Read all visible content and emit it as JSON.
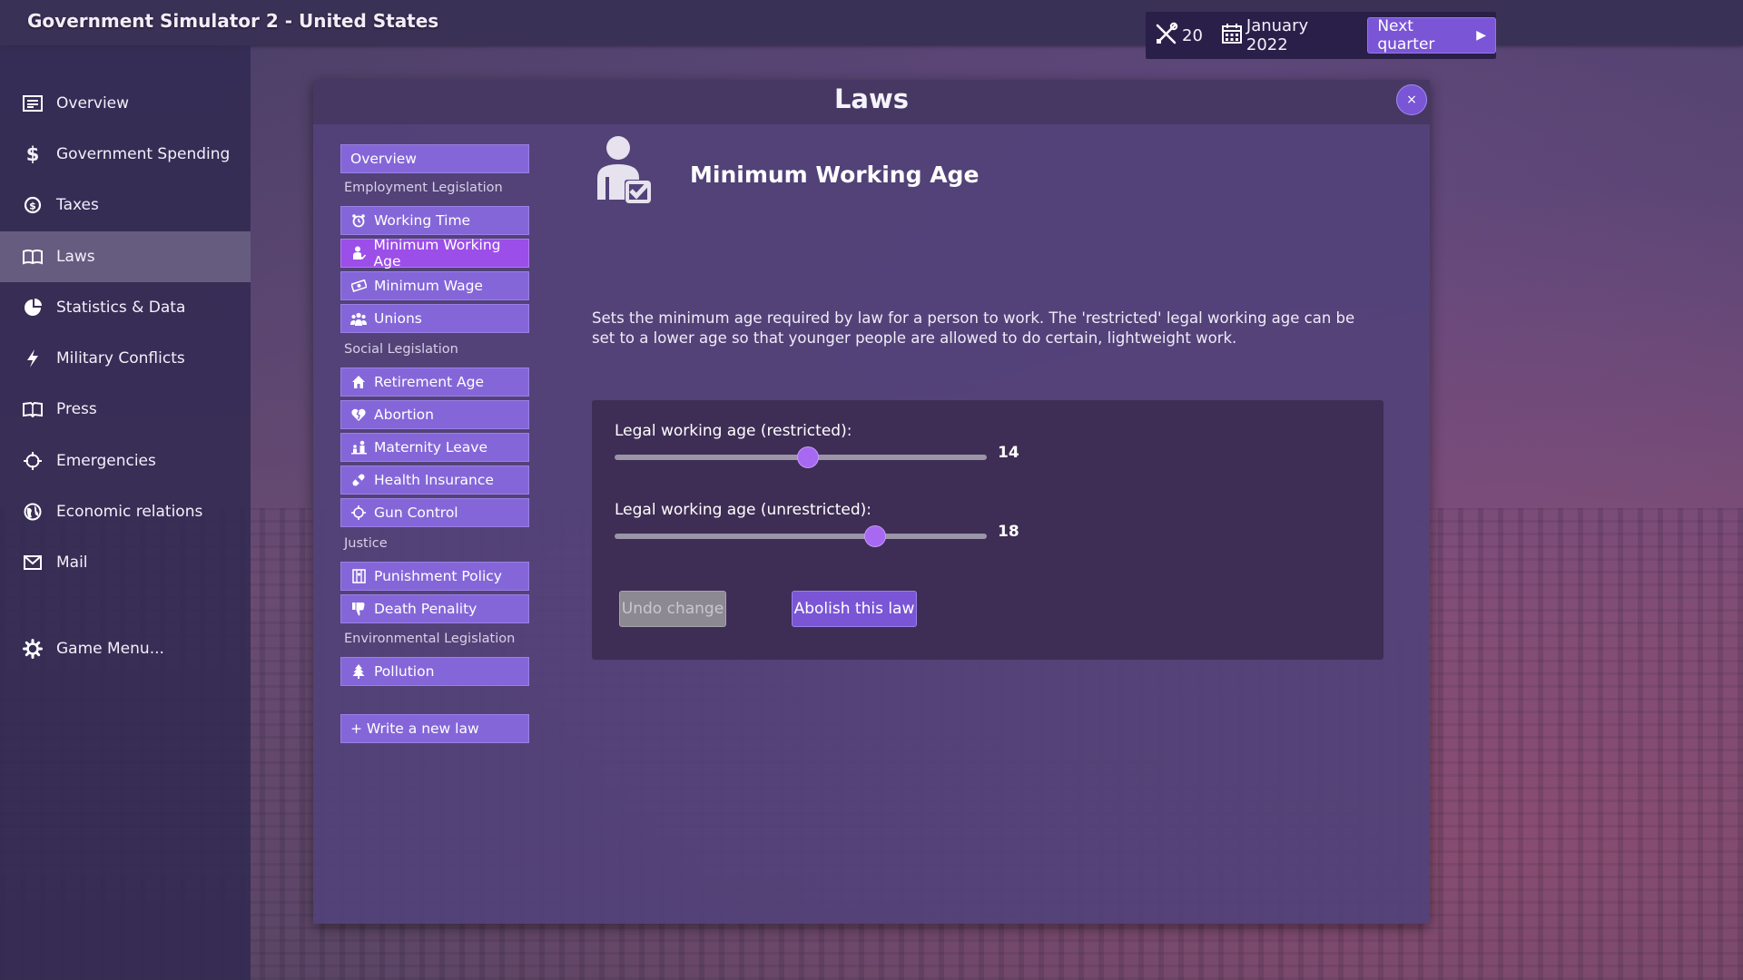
{
  "app": {
    "title": "Government Simulator 2 - United States"
  },
  "status": {
    "points": "20",
    "date": "January 2022",
    "next_label": "Next quarter",
    "points_icon": "tools-icon",
    "date_icon": "calendar-icon"
  },
  "sidebar": {
    "items": [
      {
        "label": "Overview",
        "icon": "newspaper-icon"
      },
      {
        "label": "Government Spending",
        "icon": "dollar-icon"
      },
      {
        "label": "Taxes",
        "icon": "coin-icon"
      },
      {
        "label": "Laws",
        "icon": "book-icon",
        "active": true
      },
      {
        "label": "Statistics & Data",
        "icon": "pie-chart-icon"
      },
      {
        "label": "Military Conflicts",
        "icon": "bolt-icon"
      },
      {
        "label": "Press",
        "icon": "open-book-icon"
      },
      {
        "label": "Emergencies",
        "icon": "crosshair-icon"
      },
      {
        "label": "Economic relations",
        "icon": "globe-icon"
      },
      {
        "label": "Mail",
        "icon": "envelope-icon"
      }
    ],
    "game_menu": {
      "label": "Game Menu...",
      "icon": "gear-icon"
    }
  },
  "modal": {
    "title": "Laws",
    "close_label": "×"
  },
  "lawlist": {
    "overview": "Overview",
    "categories": {
      "employment": "Employment Legislation",
      "social": "Social Legislation",
      "justice": "Justice",
      "environmental": "Environmental Legislation"
    },
    "items": {
      "working_time": "Working Time",
      "minimum_working_age": "Minimum Working Age",
      "minimum_wage": "Minimum Wage",
      "unions": "Unions",
      "retirement_age": "Retirement Age",
      "abortion": "Abortion",
      "maternity_leave": "Maternity Leave",
      "health_insurance": "Health Insurance",
      "gun_control": "Gun Control",
      "punishment_policy": "Punishment Policy",
      "death_penality": "Death Penality",
      "pollution": "Pollution"
    },
    "write_new": "+ Write a new law"
  },
  "detail": {
    "title": "Minimum Working Age",
    "description": "Sets the minimum age required by law for a person to work. The 'restricted' legal working age can be set to a lower age so that younger people are allowed to do certain, lightweight work.",
    "sliders": [
      {
        "label": "Legal working age (restricted):",
        "value": "14",
        "fraction": 0.52
      },
      {
        "label": "Legal working age (unrestricted):",
        "value": "18",
        "fraction": 0.7
      }
    ],
    "undo_label": "Undo change",
    "abolish_label": "Abolish this law"
  },
  "colors": {
    "accent": "#7a55d6",
    "active_law": "#9b4ee8",
    "slider_thumb": "#a768f2"
  }
}
